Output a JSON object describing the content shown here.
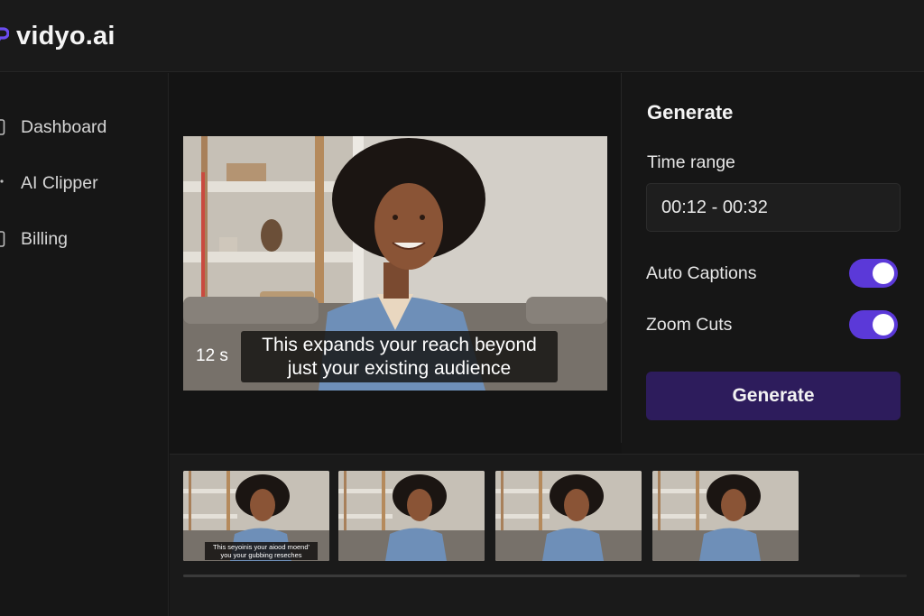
{
  "app": {
    "name": "vidyo.ai"
  },
  "sidebar": {
    "items": [
      {
        "label": "Dashboard",
        "icon": "dashboard-icon"
      },
      {
        "label": "AI Clipper",
        "icon": "sparkle-icon"
      },
      {
        "label": "Billing",
        "icon": "billing-icon"
      }
    ]
  },
  "player": {
    "time_label": "12 s",
    "caption_line1": "This expands your reach beyond",
    "caption_line2": "just your existing audience"
  },
  "panel": {
    "title": "Generate",
    "time_range_label": "Time range",
    "time_range_value": "00:12 - 00:32",
    "auto_captions_label": "Auto Captions",
    "auto_captions_on": true,
    "zoom_cuts_label": "Zoom Cuts",
    "zoom_cuts_on": true,
    "generate_label": "Generate"
  },
  "clips": {
    "first_caption_line1": "This seyoinis your aiood moend'",
    "first_caption_line2": "you your gubbing reseches",
    "count": 4
  },
  "colors": {
    "accent": "#5b39d8",
    "button": "#2d1c5c",
    "background": "#141414"
  }
}
